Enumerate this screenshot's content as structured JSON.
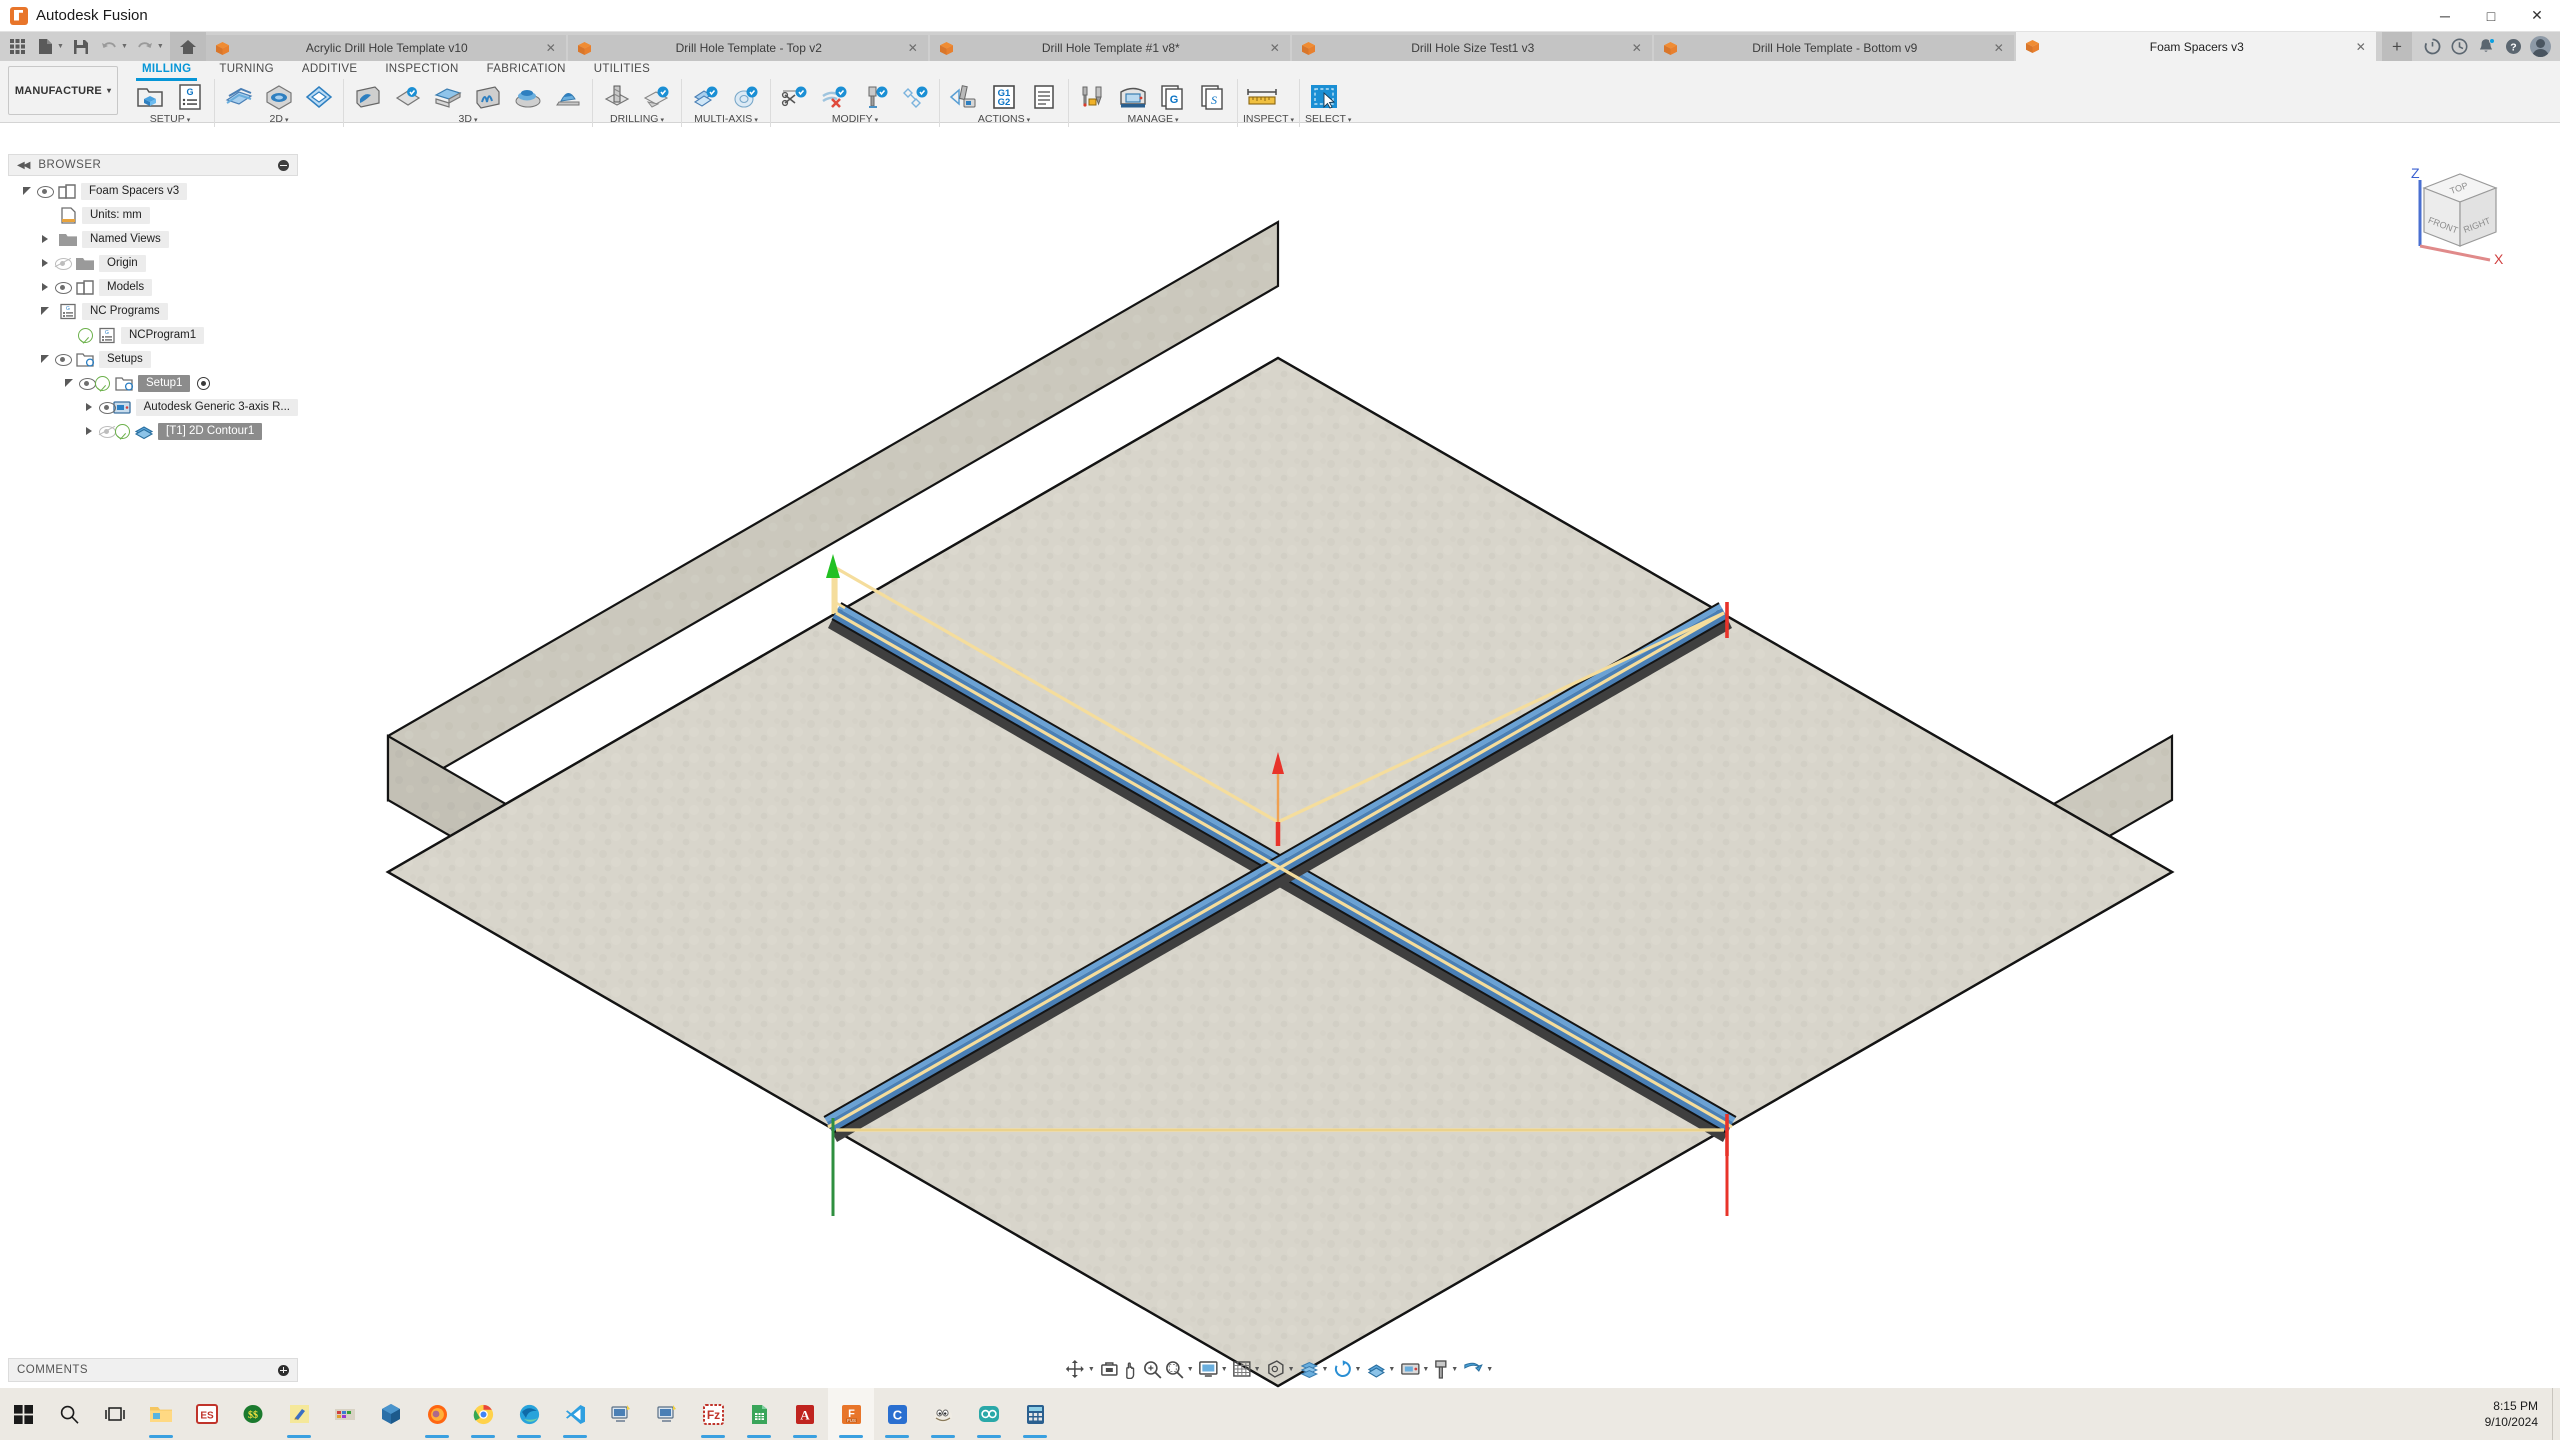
{
  "window": {
    "app_title": "Autodesk Fusion",
    "minimize": "─",
    "maximize": "□",
    "close": "✕"
  },
  "quick_access": {
    "grid_icon": "app-grid-icon",
    "new_icon": "new-document-icon",
    "save_icon": "save-icon",
    "undo_icon": "undo-icon",
    "redo_icon": "redo-icon",
    "home_icon": "home-icon"
  },
  "tabs": [
    {
      "label": "Acrylic Drill Hole Template v10",
      "active": false,
      "close": "✕"
    },
    {
      "label": "Drill Hole Template - Top v2",
      "active": false,
      "close": "✕"
    },
    {
      "label": "Drill Hole Template #1 v8*",
      "active": false,
      "close": "✕"
    },
    {
      "label": "Drill Hole Size Test1 v3",
      "active": false,
      "close": "✕"
    },
    {
      "label": "Drill Hole Template - Bottom v9",
      "active": false,
      "close": "✕"
    },
    {
      "label": "Foam Spacers v3",
      "active": true,
      "close": "✕"
    }
  ],
  "tab_actions": {
    "new_tab": "+",
    "refresh_icon": "refresh-icon",
    "recent_icon": "clock-history-icon",
    "notifications_icon": "bell-icon",
    "help_icon": "help-icon",
    "account_icon": "user-avatar-icon"
  },
  "ribbon": {
    "workspace": "MANUFACTURE",
    "workspace_caret": "▾",
    "tabs": [
      {
        "label": "MILLING",
        "active": true
      },
      {
        "label": "TURNING",
        "active": false
      },
      {
        "label": "ADDITIVE",
        "active": false
      },
      {
        "label": "INSPECTION",
        "active": false
      },
      {
        "label": "FABRICATION",
        "active": false
      },
      {
        "label": "UTILITIES",
        "active": false
      }
    ],
    "panels": [
      {
        "label": "SETUP",
        "caret": "▾",
        "icons": [
          "setup-icon",
          "nc-program-icon"
        ]
      },
      {
        "label": "2D",
        "caret": "▾",
        "icons": [
          "face-icon",
          "adaptive-2d-icon",
          "pocket-2d-icon"
        ]
      },
      {
        "label": "3D",
        "caret": "▾",
        "icons": [
          "adaptive-3d-icon",
          "pocket-3d-icon",
          "horizontal-icon",
          "parallel-icon",
          "contour-icon",
          "ramp-icon"
        ]
      },
      {
        "label": "DRILLING",
        "caret": "▾",
        "icons": [
          "drill-icon",
          "bore-icon"
        ]
      },
      {
        "label": "MULTI-AXIS",
        "caret": "▾",
        "icons": [
          "swarf-icon",
          "multi-axis-contour-icon"
        ]
      },
      {
        "label": "MODIFY",
        "caret": "▾",
        "icons": [
          "trim-toolpath-icon",
          "delete-toolpath-icon",
          "tool-library-icon",
          "transform-icon"
        ]
      },
      {
        "label": "ACTIONS",
        "caret": "▾",
        "icons": [
          "simulate-icon",
          "post-process-icon",
          "setup-sheet-icon"
        ]
      },
      {
        "label": "MANAGE",
        "caret": "▾",
        "icons": [
          "tool-library-manage-icon",
          "machine-library-icon",
          "post-library-icon",
          "template-library-icon"
        ]
      },
      {
        "label": "INSPECT",
        "caret": "▾",
        "icons": [
          "measure-icon"
        ]
      },
      {
        "label": "SELECT",
        "caret": "▾",
        "icons": [
          "select-tool-icon"
        ]
      }
    ]
  },
  "browser": {
    "header": "BROWSER",
    "collapse_icon": "collapse-panel-icon",
    "minimize_icon": "minimize-panel-icon",
    "nodes": [
      {
        "label": "Foam Spacers v3",
        "indent": 0,
        "twisty": "down",
        "eye": "on",
        "icon": "document-icon",
        "selected": false
      },
      {
        "label": "Units: mm",
        "indent": 1,
        "twisty": "none",
        "eye": "none",
        "icon": "units-icon",
        "selected": false
      },
      {
        "label": "Named Views",
        "indent": 1,
        "twisty": "right",
        "eye": "none",
        "icon": "folder-icon",
        "selected": false
      },
      {
        "label": "Origin",
        "indent": 1,
        "twisty": "right",
        "eye": "off",
        "icon": "folder-icon",
        "selected": false
      },
      {
        "label": "Models",
        "indent": 1,
        "twisty": "right",
        "eye": "on",
        "icon": "component-icon",
        "selected": false
      },
      {
        "label": "NC Programs",
        "indent": 1,
        "twisty": "down",
        "eye": "none",
        "icon": "nc-program-icon",
        "selected": false
      },
      {
        "label": "NCProgram1",
        "indent": 2,
        "twisty": "none",
        "eye": "none",
        "check": true,
        "icon": "nc-program-icon",
        "selected": false
      },
      {
        "label": "Setups",
        "indent": 1,
        "twisty": "down",
        "eye": "on",
        "icon": "setup-icon",
        "selected": false
      },
      {
        "label": "Setup1",
        "indent": 2,
        "twisty": "down",
        "eye": "on",
        "check": true,
        "icon": "setup-icon",
        "selected": true,
        "radio": true
      },
      {
        "label": "Autodesk Generic 3-axis R...",
        "indent": 3,
        "twisty": "right",
        "eye": "on",
        "icon": "machine-icon",
        "selected": false
      },
      {
        "label": "[T1] 2D Contour1",
        "indent": 3,
        "twisty": "right",
        "eye": "off",
        "check": true,
        "icon": "toolpath-icon",
        "selected": true
      }
    ]
  },
  "comments": {
    "title": "COMMENTS",
    "add_icon": "add-comment-icon"
  },
  "viewcube": {
    "top": "TOP",
    "front": "FRONT",
    "right": "RIGHT",
    "axis_z": "Z",
    "axis_x": "X"
  },
  "navbar": {
    "items": [
      {
        "icon": "orbit-icon",
        "caret": true
      },
      {
        "icon": "look-at-icon",
        "caret": false
      },
      {
        "icon": "pan-icon",
        "caret": false
      },
      {
        "icon": "zoom-icon",
        "caret": false
      },
      {
        "icon": "fit-icon",
        "caret": true
      },
      {
        "icon": "display-settings-icon",
        "caret": true
      },
      {
        "icon": "grid-snap-icon",
        "caret": true
      },
      {
        "icon": "viewports-icon",
        "caret": true
      },
      {
        "icon": "stock-visibility-icon",
        "caret": true
      },
      {
        "icon": "refresh-toolpath-icon",
        "caret": true
      },
      {
        "icon": "toolpath-visibility-icon",
        "caret": true
      },
      {
        "icon": "machine-visibility-icon",
        "caret": true
      },
      {
        "icon": "tool-visibility-icon",
        "caret": true
      },
      {
        "icon": "simulation-icon",
        "caret": true
      }
    ]
  },
  "model": {
    "material_color": "#d8d5cb",
    "toolpath_cut_color": "#4a7fb5",
    "toolpath_rapid_color": "#f5dd9c",
    "retract_color": "#e8332a",
    "lead_color": "#22c022",
    "edge_color": "#141414",
    "description": "Isometric foam spacer plate with cross-shaped 2D contour toolpath"
  },
  "taskbar": {
    "apps": [
      "windows-start-icon",
      "search-icon",
      "task-view-icon",
      "file-explorer-icon",
      "eagle-icon",
      "notes-icon",
      "editor-icon",
      "paint-icon",
      "fusion-360-icon",
      "firefox-icon",
      "chrome-icon",
      "edge-icon",
      "vscode-icon",
      "remote-desktop-icon",
      "network-icon",
      "filezilla-icon",
      "excel-icon",
      "acrobat-icon",
      "fusion-icon",
      "cura-icon",
      "gimp-icon",
      "arduino-icon",
      "calculator-icon"
    ],
    "time": "8:15 PM",
    "date": "9/10/2024",
    "show_desktop": "show-desktop-icon"
  }
}
